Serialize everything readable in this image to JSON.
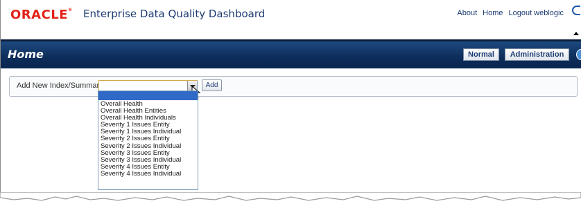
{
  "header": {
    "logo_text": "ORACLE",
    "app_title": "Enterprise Data Quality Dashboard",
    "links": [
      "About",
      "Home",
      "Logout weblogic"
    ]
  },
  "homebar": {
    "title": "Home",
    "normal_label": "Normal",
    "admin_label": "Administration"
  },
  "add_panel": {
    "label": "Add New Index/Summary",
    "select_value": "",
    "add_label": "Add"
  },
  "dropdown": {
    "options": [
      "Overall Health",
      "Overall Health Entities",
      "Overall Health Individuals",
      "Severity 1 Issues Entity",
      "Severity 1 Issues Individual",
      "Severity 2 Issues Entity",
      "Severity 2 Issues Individual",
      "Severity 3 Issues Entity",
      "Severity 3 Issues Individual",
      "Severity 4 Issues Entity",
      "Severity 4 Issues Individual"
    ]
  },
  "colors": {
    "brand_red": "#e2231a",
    "nav_blue": "#0d2d5a",
    "link_blue": "#1e3c72",
    "selection_blue": "#3169c6"
  }
}
